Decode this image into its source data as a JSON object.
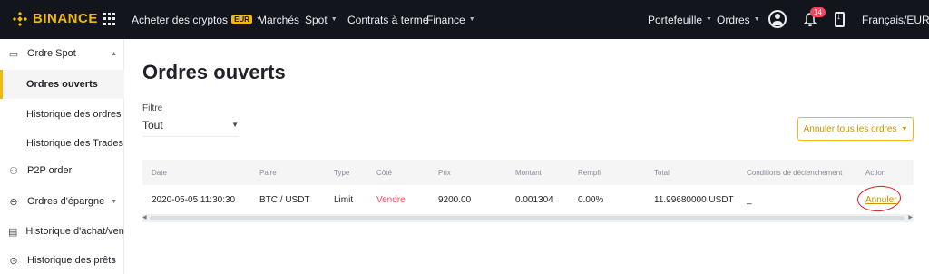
{
  "brand": {
    "name": "BINANCE",
    "color": "#f0b90b"
  },
  "nav": {
    "buy_crypto": "Acheter des cryptos",
    "buy_crypto_badge": "EUR",
    "markets": "Marchés",
    "spot": "Spot",
    "futures": "Contrats à terme",
    "finance": "Finance",
    "wallet": "Portefeuille",
    "orders": "Ordres",
    "notifications_count": "14",
    "language": "Français/EUR"
  },
  "sidebar": {
    "items": [
      {
        "label": "Ordre Spot",
        "icon": "spot-order-icon"
      },
      {
        "label": "Ordres ouverts"
      },
      {
        "label": "Historique des ordres"
      },
      {
        "label": "Historique des Trades"
      },
      {
        "label": "P2P order",
        "icon": "p2p-icon"
      },
      {
        "label": "Ordres d'épargne",
        "icon": "savings-icon"
      },
      {
        "label": "Historique d'achat/vente",
        "icon": "document-icon"
      },
      {
        "label": "Historique des prêts",
        "icon": "loan-icon"
      }
    ]
  },
  "main": {
    "title": "Ordres ouverts",
    "filter_label": "Filtre",
    "filter_value": "Tout",
    "cancel_all": "Annuler tous les ordres"
  },
  "table": {
    "columns": [
      "Date",
      "Paire",
      "Type",
      "Côté",
      "Prix",
      "Montant",
      "Rempli",
      "Total",
      "Conditions de déclenchement",
      "Action"
    ],
    "rows": [
      {
        "date": "2020-05-05 11:30:30",
        "pair": "BTC / USDT",
        "type": "Limit",
        "side": "Vendre",
        "price": "9200.00",
        "amount": "0.001304",
        "filled": "0.00%",
        "total": "11.99680000 USDT",
        "conditions": "_",
        "action": "Annuler"
      }
    ]
  },
  "colors": {
    "sell": "#f6465d",
    "accent": "#f0b90b",
    "annotation": "#d9181f"
  }
}
